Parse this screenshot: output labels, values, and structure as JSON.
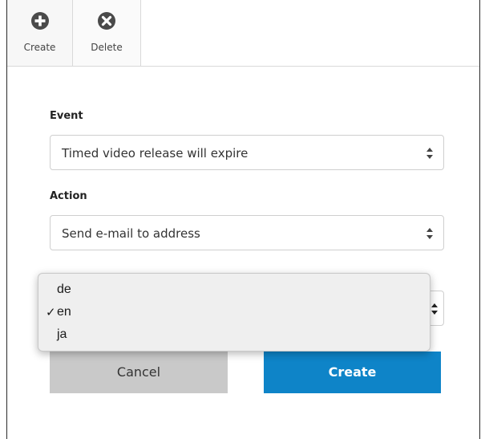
{
  "toolbar": {
    "create_label": "Create",
    "delete_label": "Delete"
  },
  "form": {
    "event": {
      "label": "Event",
      "value": "Timed video release will expire"
    },
    "action": {
      "label": "Action",
      "value": "Send e-mail to address"
    },
    "notification_language": {
      "options": [
        "de",
        "en",
        "ja"
      ],
      "selected": "en"
    }
  },
  "buttons": {
    "cancel": "Cancel",
    "create": "Create"
  },
  "colors": {
    "primary": "#0e84c8",
    "cancel_bg": "#c9c9c9"
  },
  "icons": {
    "create": "plus-circle-icon",
    "delete": "x-circle-icon",
    "select_arrows": "updown-arrows-icon",
    "checkmark": "checkmark-icon"
  }
}
